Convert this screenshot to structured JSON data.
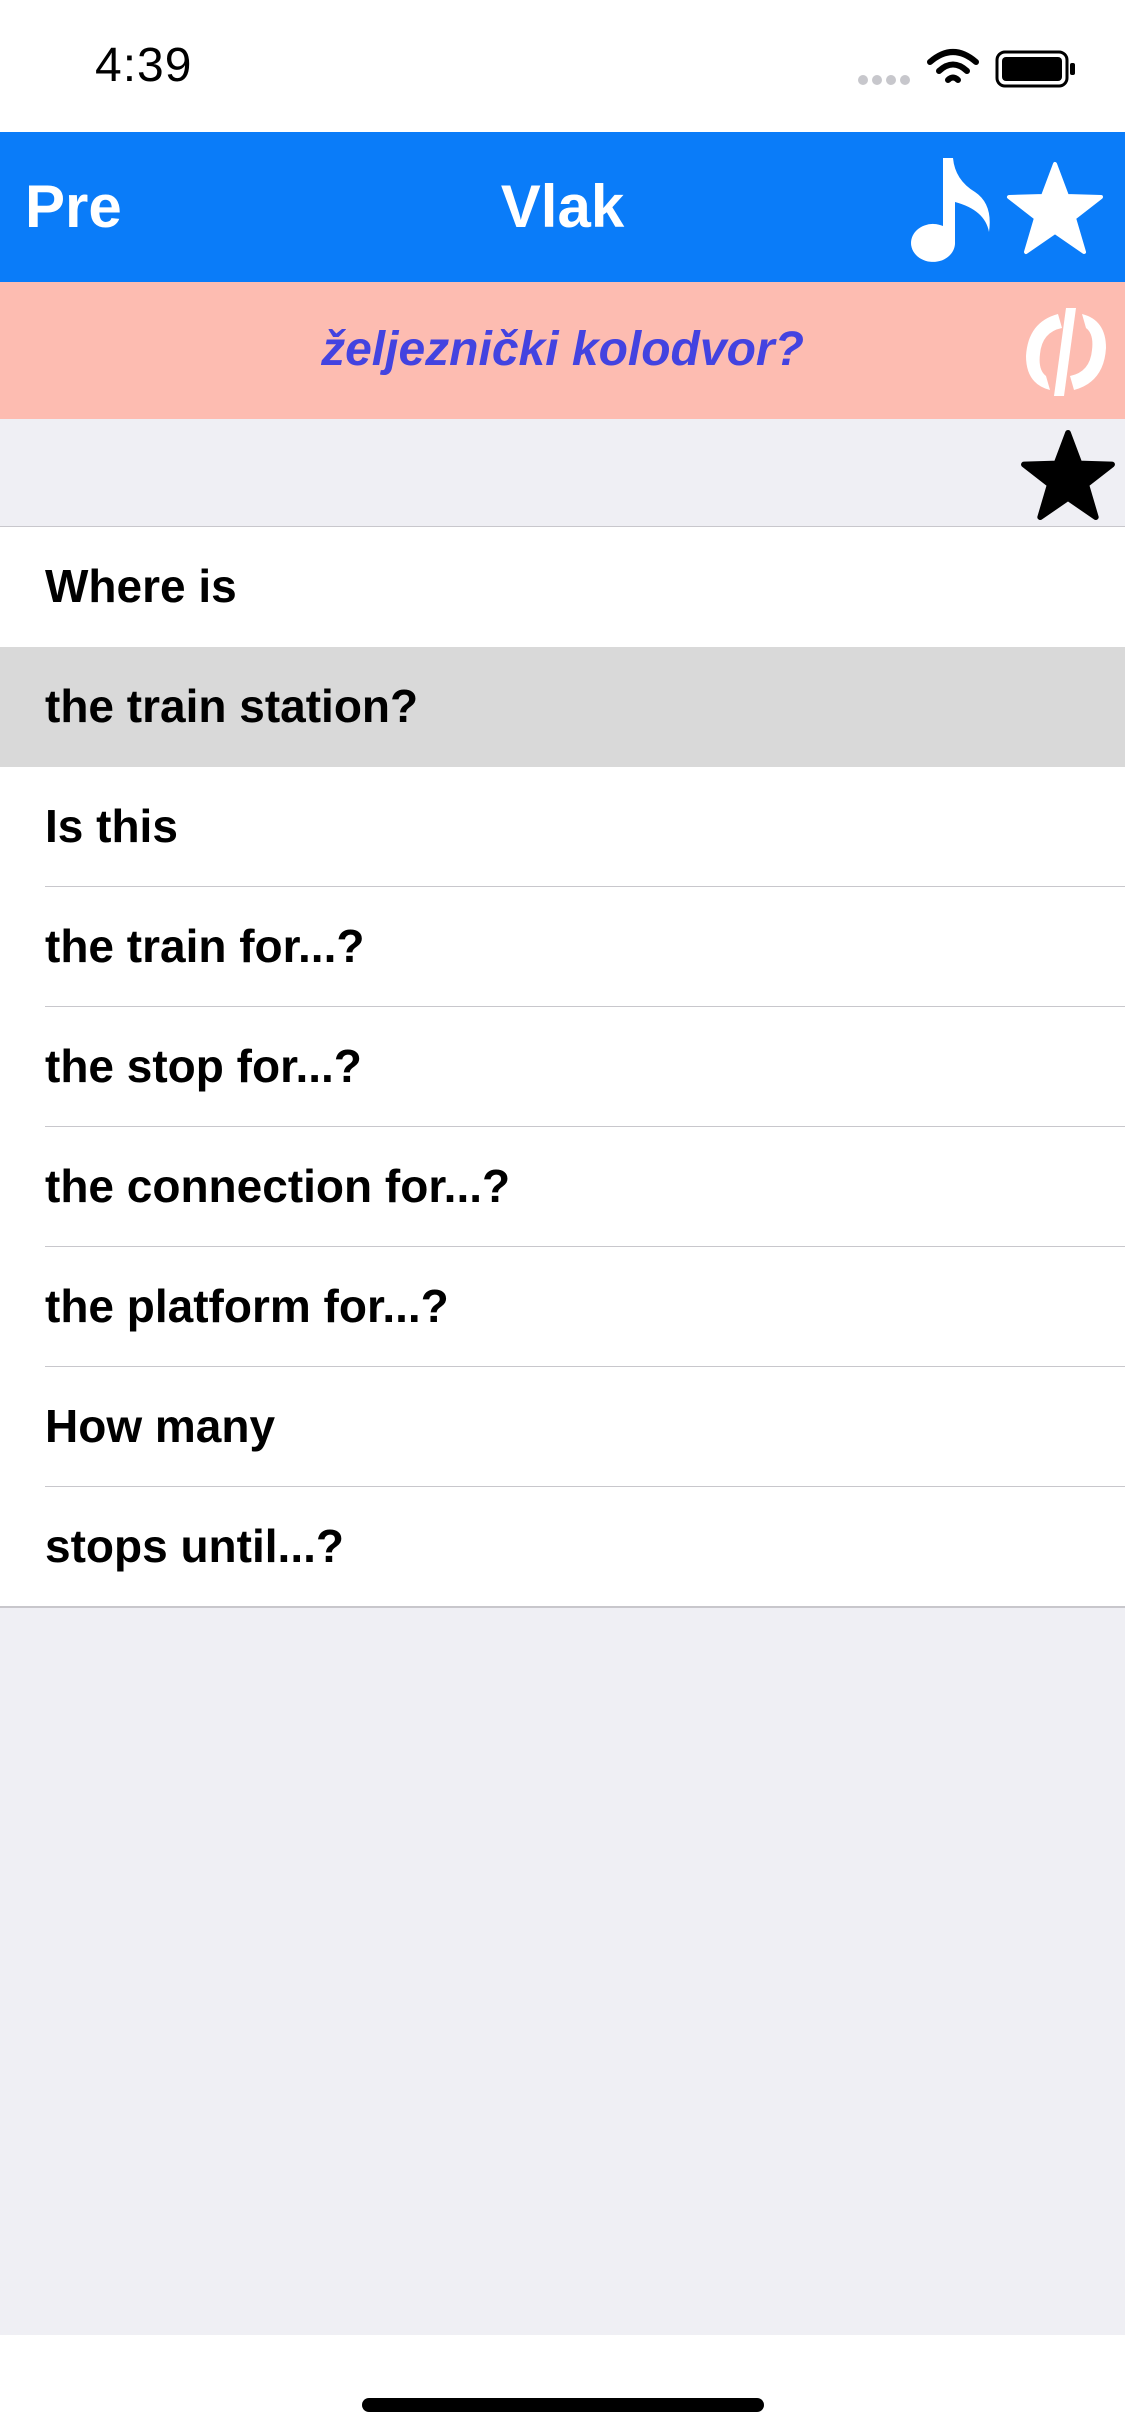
{
  "status_bar": {
    "time": "4:39",
    "icons": [
      "signal-dots-icon",
      "wifi-icon",
      "battery-icon"
    ]
  },
  "nav": {
    "back_label": "Pre",
    "title": "Vlak",
    "icons": [
      "music-note-icon",
      "star-icon"
    ],
    "background_color": "#0a7cf9"
  },
  "translation": {
    "text": "željeznički kolodvor?",
    "background_color": "#fdbcb1",
    "text_color": "#4343e0",
    "logo_icon": "phrase-logo-icon"
  },
  "favorite": {
    "icon": "star-icon"
  },
  "phrases": [
    {
      "label": "Where is",
      "selected": false
    },
    {
      "label": "the train station?",
      "selected": true
    },
    {
      "label": "Is this",
      "selected": false
    },
    {
      "label": "the train for...?",
      "selected": false
    },
    {
      "label": "the stop for...?",
      "selected": false
    },
    {
      "label": "the connection for...?",
      "selected": false
    },
    {
      "label": "the platform for...?",
      "selected": false
    },
    {
      "label": "How many",
      "selected": false
    },
    {
      "label": "stops until...?",
      "selected": false
    }
  ]
}
